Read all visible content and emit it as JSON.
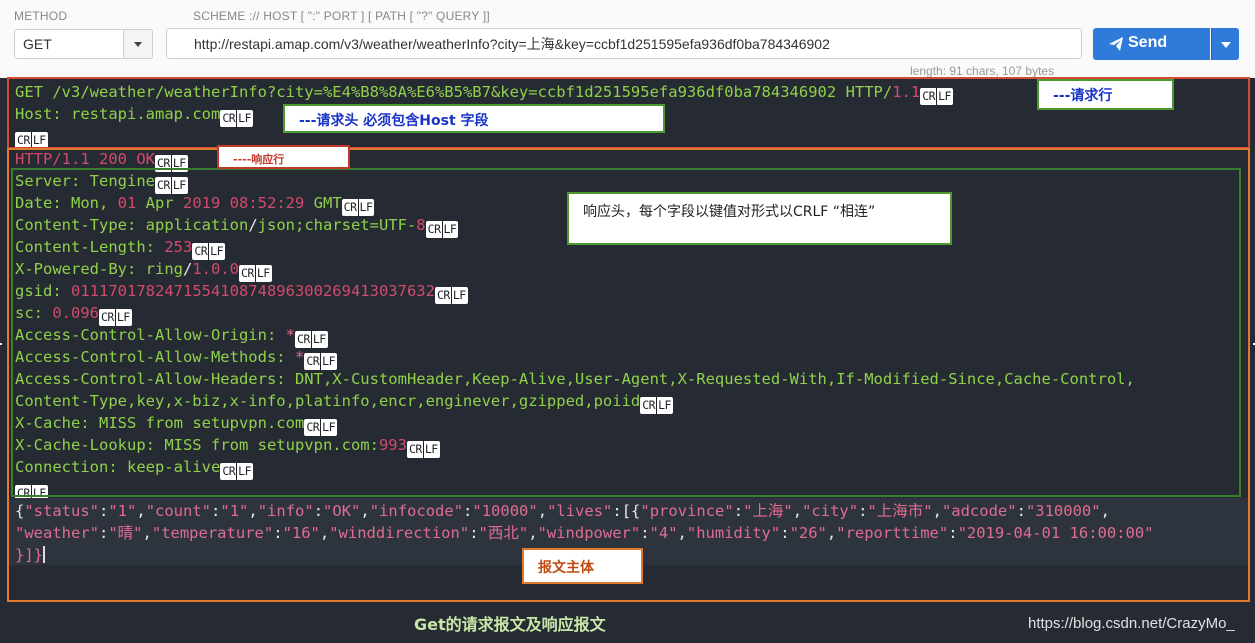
{
  "request_bar": {
    "method_label": "METHOD",
    "method_value": "GET",
    "scheme_label": "SCHEME :// HOST [ \":\" PORT ] [ PATH [ \"?\" QUERY ]]",
    "url_value": "http://restapi.amap.com/v3/weather/weatherInfo?city=上海&key=ccbf1d251595efa936df0ba784346902",
    "send_label": "Send",
    "length_info": "length: 91 chars, 107 bytes"
  },
  "crlf": {
    "cr": "CR",
    "lf": "LF"
  },
  "request": {
    "line": {
      "method": "GET",
      "p1": "/v3/weather/weatherInfo?city=%E4%B8%8A%E6%B5%B7&key=ccbf1d251595efa936df0ba784346902",
      "version_a": "HTTP/",
      "version_b": "1.1"
    },
    "host_key": "Host: ",
    "host_val": "restapi.amap.com"
  },
  "response": {
    "status_a": "HTTP/",
    "status_b": "1.1 200 OK",
    "headers": {
      "server_k": "Server: ",
      "server_v": "Tengine",
      "date_k": "Date: ",
      "date_v1": "Mon, ",
      "date_v2": "01",
      "date_v3": " Apr ",
      "date_v4": "2019 08:52:29",
      "date_v5": " GMT",
      "ct_k": "Content-Type: ",
      "ct_v1": "application",
      "ct_v2": "/",
      "ct_v3": "json;charset=UTF-",
      "ct_v4": "8",
      "cl_k": "Content-Length: ",
      "cl_v": "253",
      "xpb_k": "X-Powered-By: ",
      "xpb_v1": "ring",
      "xpb_v2": "/",
      "xpb_v3": "1.0.0",
      "gsid_k": "gsid: ",
      "gsid_v": "011170178247155410874896300269413037632",
      "sc_k": "sc: ",
      "sc_v": "0.096",
      "acao_k": "Access-Control-Allow-Origin: ",
      "acao_v": "*",
      "acam_k": "Access-Control-Allow-Methods: ",
      "acam_v": "*",
      "acah_k": "Access-Control-Allow-Headers: ",
      "acah_v1": "DNT,X-CustomHeader,Keep-Alive,User-Agent,X-Requested-With,If-Modified-Since,Cache-Control,",
      "acah_v2": "Content-Type,key,x-biz,x-info,platinfo,encr,enginever,gzipped,poiid",
      "xc_k": "X-Cache: ",
      "xc_v": "MISS from setupvpn.com",
      "xcl_k": "X-Cache-Lookup: ",
      "xcl_v1": "MISS from setupvpn.com:",
      "xcl_v2": "993",
      "conn_k": "Connection: ",
      "conn_v": "keep-alive"
    },
    "body": {
      "b1": "{",
      "k_status": "\"status\"",
      "v_status": "\"1\"",
      "k_count": "\"count\"",
      "v_count": "\"1\"",
      "k_info": "\"info\"",
      "v_info": "\"OK\"",
      "k_infocode": "\"infocode\"",
      "v_infocode": "\"10000\"",
      "k_lives": "\"lives\"",
      "k_province": "\"province\"",
      "v_province": "\"上海\"",
      "k_city": "\"city\"",
      "v_city": "\"上海市\"",
      "k_adcode": "\"adcode\"",
      "v_adcode": "\"310000\"",
      "k_weather": "\"weather\"",
      "v_weather": "\"晴\"",
      "k_temperature": "\"temperature\"",
      "v_temperature": "\"16\"",
      "k_winddirection": "\"winddirection\"",
      "v_winddirection": "\"西北\"",
      "k_windpower": "\"windpower\"",
      "v_windpower": "\"4\"",
      "k_humidity": "\"humidity\"",
      "v_humidity": "\"26\"",
      "k_reporttime": "\"reporttime\"",
      "v_reporttime": "\"2019-04-01 16:00:00\"",
      "end": "}]}"
    }
  },
  "annotations": {
    "request_line": "---请求行",
    "request_header": "---请求头 必须包含Host 字段",
    "response_line": "----响应行",
    "response_header": "响应头，每个字段以键值对形式以CRLF “相连”",
    "message_body": "报文主体"
  },
  "caption": "Get的请求报文及响应报文",
  "watermark": "https://blog.csdn.net/CrazyMo_",
  "colors": {
    "send_button": "#2f7bd9",
    "code_background": "#262b33",
    "header_key": "#8fd14a",
    "value": "#d24a6d",
    "request_box": "#d14b35",
    "response_box": "#e07a2c",
    "header_box": "#3a7d2c"
  }
}
